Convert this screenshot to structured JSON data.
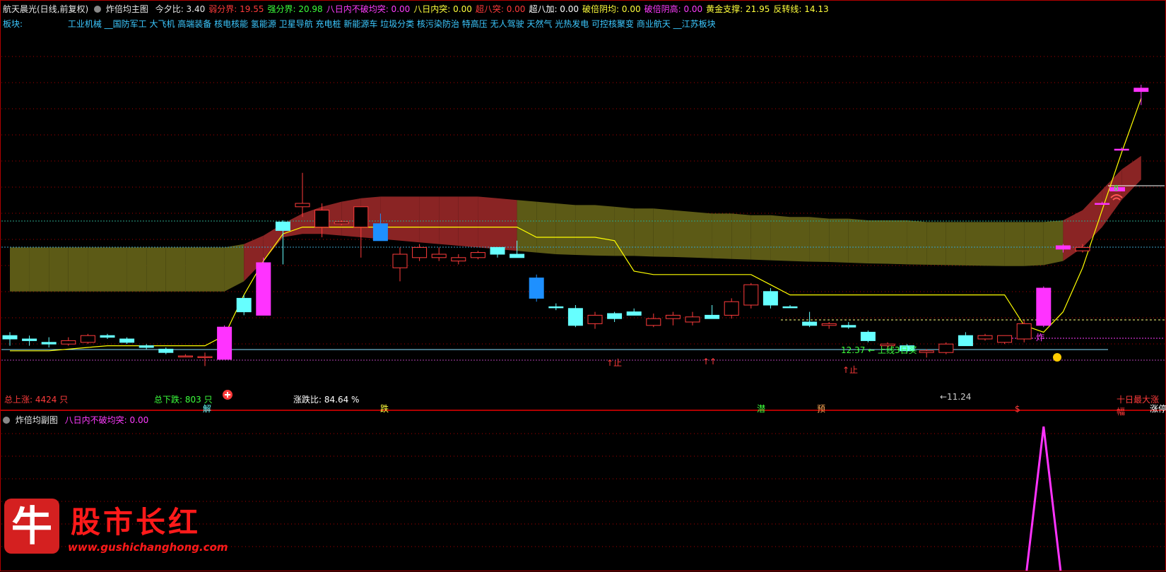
{
  "header": {
    "title": "航天晨光(日线,前复权)",
    "indicator": "炸倍均主图",
    "items": [
      {
        "label": "今夕比:",
        "value": "3.40",
        "color": "#e8e8e8"
      },
      {
        "label": "弱分界:",
        "value": "19.55",
        "color": "#ff3b3b"
      },
      {
        "label": "强分界:",
        "value": "20.98",
        "color": "#3cff3c"
      },
      {
        "label": "八日内不破均突:",
        "value": "0.00",
        "color": "#ff3cff"
      },
      {
        "label": "八日内突:",
        "value": "0.00",
        "color": "#ffff3c"
      },
      {
        "label": "超八突:",
        "value": "0.00",
        "color": "#ff3b3b"
      },
      {
        "label": "超八加:",
        "value": "0.00",
        "color": "#ffffff"
      },
      {
        "label": "破倍阴均:",
        "value": "0.00",
        "color": "#ffff3c"
      },
      {
        "label": "破倍阴高:",
        "value": "0.00",
        "color": "#ff3cff"
      },
      {
        "label": "黄金支撑:",
        "value": "21.95",
        "color": "#ffff3c"
      },
      {
        "label": "反转线:",
        "value": "14.13",
        "color": "#ffff3c"
      }
    ]
  },
  "sectors": {
    "label": "板块:",
    "list": "工业机械 __国防军工 大飞机 高端装备 核电核能 氢能源 卫星导航 充电桩 新能源车 垃圾分类 核污染防治 特高压 无人驾驶 天然气 光热发电 可控核聚变 商业航天 __江苏板块"
  },
  "stats": {
    "total_up": "总上涨: 4424 只",
    "total_down": "总下跌: 803 只",
    "ratio": "涨跌比: 84.64 %"
  },
  "annotations": {
    "signal_text": "12.37 ← 上线3日买",
    "low_text": "←11.24",
    "ten_day": "十日最大涨幅",
    "markers": [
      {
        "t": "解",
        "c": "#66ffff"
      },
      {
        "t": "跌",
        "c": "#ffff3c"
      },
      {
        "t": "潜",
        "c": "#3cff3c"
      },
      {
        "t": "预",
        "c": "#ffaa55"
      },
      {
        "t": "$",
        "c": "#ff3b3b"
      },
      {
        "t": "涨停",
        "c": "#ffffff"
      }
    ],
    "side_tags": [
      {
        "t": "↑止",
        "c": "#ff3b3b"
      },
      {
        "t": "↑↑",
        "c": "#ff3b3b"
      },
      {
        "t": "↑止",
        "c": "#ff3b3b"
      },
      {
        "t": "炸",
        "c": "#ff3cff"
      }
    ],
    "badge": "8"
  },
  "sub": {
    "title": "炸倍均副图",
    "item_label": "八日内不破均突:",
    "item_value": "0.00",
    "item_color": "#ff3cff"
  },
  "watermark": {
    "logo_char": "牛",
    "name": "股市长红",
    "url": "www.gushichanghong.com"
  },
  "colors": {
    "up": "#ff3b3b",
    "down": "#66ffff",
    "strong_up": "#ff33ff",
    "strong_down": "#1e90ff",
    "band_green": "#5c5a16",
    "band_red": "#8a2424",
    "line": "#ffff00",
    "grid": "#b00000"
  },
  "chart_data": {
    "type": "candlestick",
    "candles": [
      {
        "o": 12.6,
        "h": 12.7,
        "l": 12.3,
        "c": 12.5
      },
      {
        "o": 12.5,
        "h": 12.6,
        "l": 12.3,
        "c": 12.45
      },
      {
        "o": 12.4,
        "h": 12.55,
        "l": 12.25,
        "c": 12.35
      },
      {
        "o": 12.35,
        "h": 12.55,
        "l": 12.3,
        "c": 12.45
      },
      {
        "o": 12.4,
        "h": 12.65,
        "l": 12.35,
        "c": 12.6
      },
      {
        "o": 12.6,
        "h": 12.65,
        "l": 12.5,
        "c": 12.55
      },
      {
        "o": 12.5,
        "h": 12.55,
        "l": 12.35,
        "c": 12.4
      },
      {
        "o": 12.3,
        "h": 12.35,
        "l": 12.2,
        "c": 12.25
      },
      {
        "o": 12.2,
        "h": 12.25,
        "l": 12.05,
        "c": 12.1
      },
      {
        "o": 12.0,
        "h": 12.05,
        "l": 11.98,
        "c": 12.0
      },
      {
        "o": 11.98,
        "h": 12.1,
        "l": 11.7,
        "c": 11.95
      },
      {
        "o": 11.9,
        "h": 12.9,
        "l": 11.9,
        "c": 12.85
      },
      {
        "o": 13.7,
        "h": 13.8,
        "l": 13.2,
        "c": 13.3
      },
      {
        "o": 13.2,
        "h": 14.9,
        "l": 13.2,
        "c": 14.75
      },
      {
        "o": 15.7,
        "h": 16.0,
        "l": 14.7,
        "c": 15.95
      },
      {
        "o": 16.4,
        "h": 17.4,
        "l": 16.1,
        "c": 16.5
      },
      {
        "o": 15.8,
        "h": 16.5,
        "l": 15.5,
        "c": 16.3
      },
      {
        "o": 15.9,
        "h": 16.0,
        "l": 15.85,
        "c": 15.95
      },
      {
        "o": 15.8,
        "h": 16.3,
        "l": 14.9,
        "c": 16.4
      },
      {
        "o": 15.9,
        "h": 16.2,
        "l": 15.4,
        "c": 15.4
      },
      {
        "o": 14.6,
        "h": 15.2,
        "l": 14.2,
        "c": 15.0
      },
      {
        "o": 14.9,
        "h": 15.3,
        "l": 14.8,
        "c": 15.2
      },
      {
        "o": 15.0,
        "h": 15.2,
        "l": 14.8,
        "c": 14.9
      },
      {
        "o": 14.8,
        "h": 15.0,
        "l": 14.7,
        "c": 14.9
      },
      {
        "o": 14.9,
        "h": 15.1,
        "l": 14.85,
        "c": 15.05
      },
      {
        "o": 15.0,
        "h": 15.2,
        "l": 14.9,
        "c": 15.2
      },
      {
        "o": 15.0,
        "h": 15.4,
        "l": 14.9,
        "c": 14.9
      },
      {
        "o": 14.3,
        "h": 14.4,
        "l": 13.6,
        "c": 13.7
      },
      {
        "o": 13.45,
        "h": 13.55,
        "l": 13.35,
        "c": 13.45
      },
      {
        "o": 13.4,
        "h": 13.5,
        "l": 12.85,
        "c": 12.9
      },
      {
        "o": 12.95,
        "h": 13.3,
        "l": 12.8,
        "c": 13.2
      },
      {
        "o": 13.1,
        "h": 13.3,
        "l": 13.0,
        "c": 13.25
      },
      {
        "o": 13.3,
        "h": 13.4,
        "l": 13.2,
        "c": 13.2
      },
      {
        "o": 12.9,
        "h": 13.25,
        "l": 12.85,
        "c": 13.1
      },
      {
        "o": 13.2,
        "h": 13.3,
        "l": 12.9,
        "c": 13.1
      },
      {
        "o": 13.0,
        "h": 13.3,
        "l": 12.9,
        "c": 13.15
      },
      {
        "o": 13.1,
        "h": 13.5,
        "l": 13.1,
        "c": 13.2
      },
      {
        "o": 13.2,
        "h": 13.7,
        "l": 13.1,
        "c": 13.6
      },
      {
        "o": 13.5,
        "h": 14.15,
        "l": 13.4,
        "c": 14.1
      },
      {
        "o": 13.9,
        "h": 14.0,
        "l": 13.4,
        "c": 13.5
      },
      {
        "o": 13.45,
        "h": 13.5,
        "l": 13.45,
        "c": 13.45
      },
      {
        "o": 13.0,
        "h": 13.3,
        "l": 12.85,
        "c": 12.9
      },
      {
        "o": 12.9,
        "h": 13.0,
        "l": 12.8,
        "c": 12.95
      },
      {
        "o": 12.9,
        "h": 13.0,
        "l": 12.8,
        "c": 12.85
      },
      {
        "o": 12.7,
        "h": 12.75,
        "l": 12.4,
        "c": 12.45
      },
      {
        "o": 12.35,
        "h": 12.4,
        "l": 12.25,
        "c": 12.3
      },
      {
        "o": 12.3,
        "h": 12.35,
        "l": 12.1,
        "c": 12.15
      },
      {
        "o": 12.1,
        "h": 12.2,
        "l": 11.95,
        "c": 12.15
      },
      {
        "o": 12.1,
        "h": 12.4,
        "l": 12.05,
        "c": 12.35
      },
      {
        "o": 12.3,
        "h": 12.7,
        "l": 12.3,
        "c": 12.6
      },
      {
        "o": 12.6,
        "h": 12.65,
        "l": 12.45,
        "c": 12.5
      },
      {
        "o": 12.4,
        "h": 12.6,
        "l": 12.35,
        "c": 12.6
      },
      {
        "o": 12.5,
        "h": 13.05,
        "l": 12.4,
        "c": 12.95
      },
      {
        "o": 12.9,
        "h": 14.05,
        "l": 12.85,
        "c": 14.0
      },
      {
        "o": 15.15,
        "h": 15.3,
        "l": 15.05,
        "c": 15.25
      },
      {
        "o": 15.1,
        "h": 15.3,
        "l": 15.05,
        "c": 15.2
      },
      {
        "o": 16.5,
        "h": 16.55,
        "l": 16.5,
        "c": 16.5
      },
      {
        "o": 18.1,
        "h": 18.15,
        "l": 18.1,
        "c": 18.1
      },
      {
        "o": 19.9,
        "h": 20.0,
        "l": 19.4,
        "c": 19.8
      }
    ],
    "colors": [
      "d",
      "d",
      "d",
      "u",
      "u",
      "d",
      "d",
      "d",
      "d",
      "u",
      "u",
      "S",
      "d",
      "S",
      "d",
      "u",
      "u",
      "u",
      "u",
      "B",
      "u",
      "u",
      "u",
      "u",
      "u",
      "d",
      "d",
      "B",
      "d",
      "d",
      "u",
      "d",
      "d",
      "u",
      "u",
      "u",
      "d",
      "u",
      "u",
      "d",
      "d",
      "d",
      "u",
      "d",
      "d",
      "u",
      "d",
      "u",
      "u",
      "d",
      "u",
      "u",
      "u",
      "S",
      "S",
      "u",
      "S",
      "S",
      "S"
    ],
    "support_line": [
      12.15,
      12.15,
      12.15,
      12.2,
      12.25,
      12.3,
      12.3,
      12.3,
      12.3,
      12.3,
      12.3,
      12.6,
      13.8,
      14.8,
      15.6,
      15.8,
      15.8,
      15.8,
      15.8,
      15.8,
      15.8,
      15.8,
      15.8,
      15.8,
      15.8,
      15.8,
      15.8,
      15.5,
      15.5,
      15.5,
      15.5,
      15.4,
      14.5,
      14.4,
      14.4,
      14.4,
      14.4,
      14.4,
      14.4,
      14.1,
      13.8,
      13.8,
      13.8,
      13.8,
      13.8,
      13.8,
      13.8,
      13.8,
      13.8,
      13.8,
      13.8,
      13.8,
      12.9,
      12.7,
      13.3,
      14.6,
      16.3,
      18.0,
      19.6
    ],
    "band_upper": [
      15.2,
      15.2,
      15.2,
      15.2,
      15.2,
      15.2,
      15.2,
      15.2,
      15.2,
      15.2,
      15.2,
      15.2,
      15.3,
      15.55,
      15.9,
      16.2,
      16.4,
      16.55,
      16.65,
      16.7,
      16.7,
      16.7,
      16.7,
      16.7,
      16.7,
      16.65,
      16.6,
      16.55,
      16.5,
      16.45,
      16.45,
      16.4,
      16.35,
      16.35,
      16.3,
      16.25,
      16.2,
      16.2,
      16.15,
      16.15,
      16.1,
      16.1,
      16.05,
      16.05,
      16.0,
      16.0,
      16.0,
      15.95,
      15.95,
      15.95,
      15.95,
      15.95,
      15.95,
      15.95,
      16.0,
      16.3,
      16.9,
      17.5,
      17.9
    ],
    "band_lower": [
      13.9,
      13.9,
      13.9,
      13.9,
      13.9,
      13.9,
      13.9,
      13.9,
      13.9,
      13.9,
      13.9,
      13.9,
      14.2,
      14.8,
      15.5,
      15.6,
      15.6,
      15.55,
      15.5,
      15.45,
      15.4,
      15.35,
      15.3,
      15.25,
      15.2,
      15.15,
      15.1,
      15.05,
      15.0,
      14.98,
      14.96,
      14.95,
      14.95,
      14.93,
      14.92,
      14.9,
      14.88,
      14.86,
      14.84,
      14.82,
      14.8,
      14.78,
      14.77,
      14.75,
      14.73,
      14.72,
      14.7,
      14.69,
      14.68,
      14.67,
      14.66,
      14.65,
      14.65,
      14.68,
      14.8,
      15.2,
      15.8,
      16.6,
      17.2
    ],
    "band_state": [
      "g",
      "g",
      "g",
      "g",
      "g",
      "g",
      "g",
      "g",
      "g",
      "g",
      "g",
      "g",
      "r",
      "r",
      "r",
      "r",
      "r",
      "r",
      "r",
      "r",
      "r",
      "r",
      "r",
      "r",
      "r",
      "r",
      "g",
      "g",
      "g",
      "g",
      "g",
      "g",
      "g",
      "g",
      "g",
      "g",
      "g",
      "g",
      "g",
      "g",
      "g",
      "g",
      "g",
      "g",
      "g",
      "g",
      "g",
      "g",
      "g",
      "g",
      "g",
      "g",
      "g",
      "g",
      "r",
      "r",
      "r",
      "r",
      "r"
    ],
    "y_range": [
      11.0,
      21.5
    ],
    "sub_spike": {
      "index": 53,
      "value": 1
    },
    "sub_range": [
      0,
      1
    ]
  }
}
